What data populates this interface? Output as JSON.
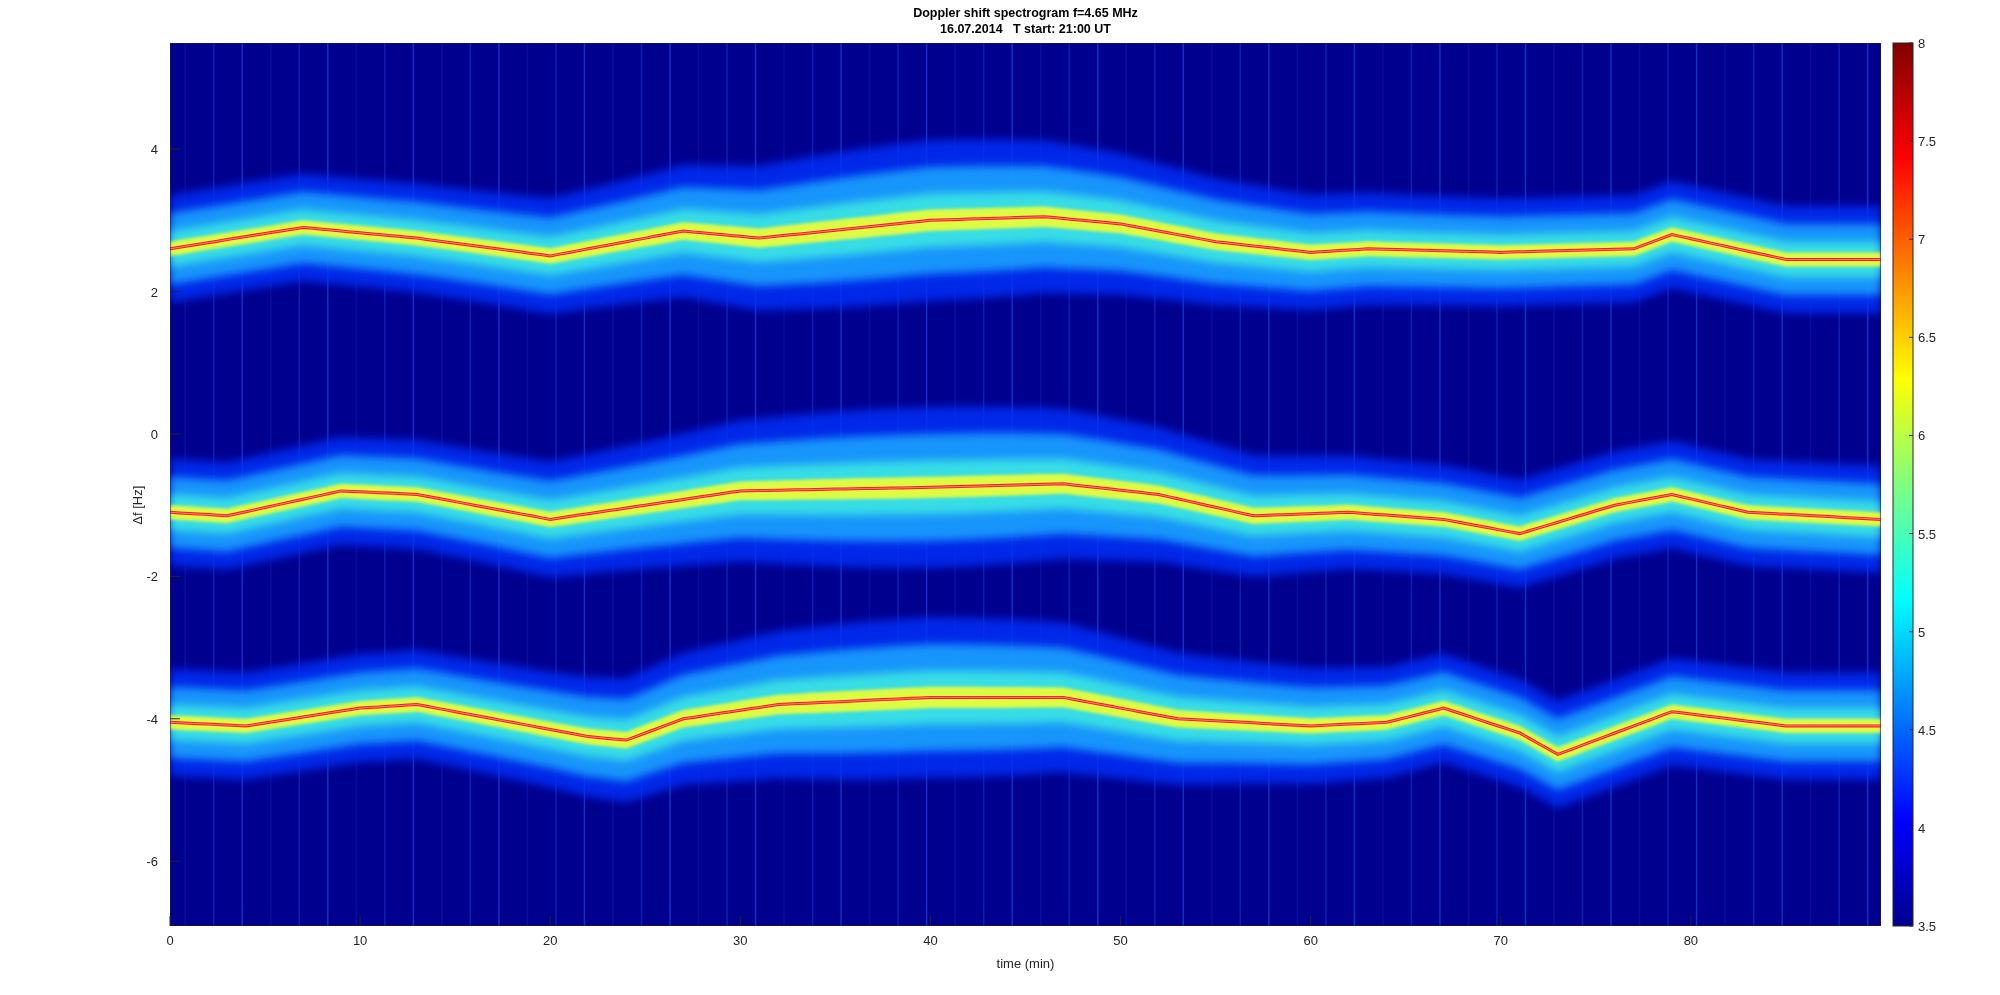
{
  "figure": {
    "title_lines": [
      "Doppler shift spectrogram f=4.65 MHz",
      "16.07.2014   T start: 21:00 UT"
    ],
    "xlabel": "time (min)",
    "ylabel": "Δf [Hz]",
    "xticks": [
      "0",
      "10",
      "20",
      "30",
      "40",
      "50",
      "60",
      "70",
      "80"
    ],
    "yticks": [
      "4",
      "2",
      "0",
      "-2",
      "-4",
      "-6"
    ],
    "colorbar_ticks": [
      "8",
      "7.5",
      "7",
      "6.5",
      "6",
      "5.5",
      "5",
      "4.5",
      "4",
      "3.5"
    ]
  }
}
